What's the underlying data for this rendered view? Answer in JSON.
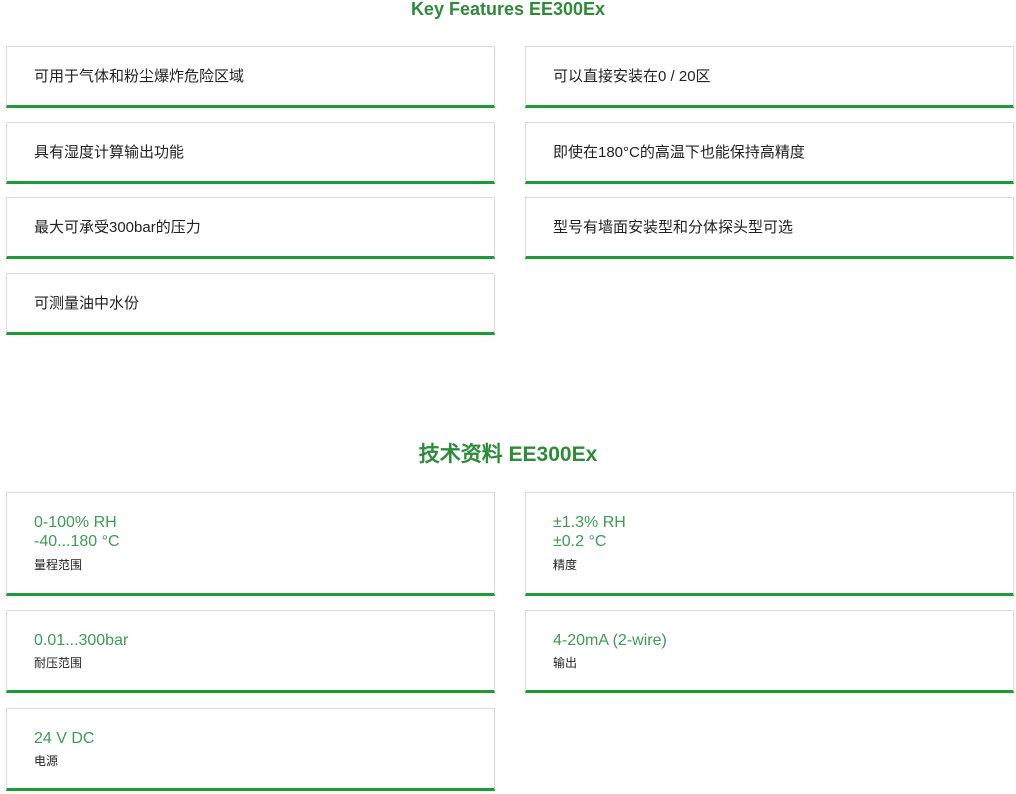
{
  "features_section": {
    "title": "Key Features EE300Ex",
    "items": [
      "可用于气体和粉尘爆炸危险区域",
      "可以直接安装在0 / 20区",
      "具有湿度计算输出功能",
      "即使在180°C的高温下也能保持高精度",
      "最大可承受300bar的压力",
      "型号有墙面安装型和分体探头型可选",
      "可测量油中水份"
    ]
  },
  "specs_section": {
    "title": "技术资料 EE300Ex",
    "items": [
      {
        "values": [
          "0-100% RH",
          "-40...180 °C"
        ],
        "label": "量程范围"
      },
      {
        "values": [
          "±1.3% RH",
          "±0.2 °C"
        ],
        "label": "精度"
      },
      {
        "values": [
          "0.01...300bar"
        ],
        "label": "耐压范围"
      },
      {
        "values": [
          "4-20mA (2-wire)"
        ],
        "label": "输出"
      },
      {
        "values": [
          "24 V DC"
        ],
        "label": "电源"
      }
    ]
  },
  "colors": {
    "accent_green": "#1f9a3a",
    "title_green": "#2e8b3a",
    "value_green": "#3e9a57"
  }
}
